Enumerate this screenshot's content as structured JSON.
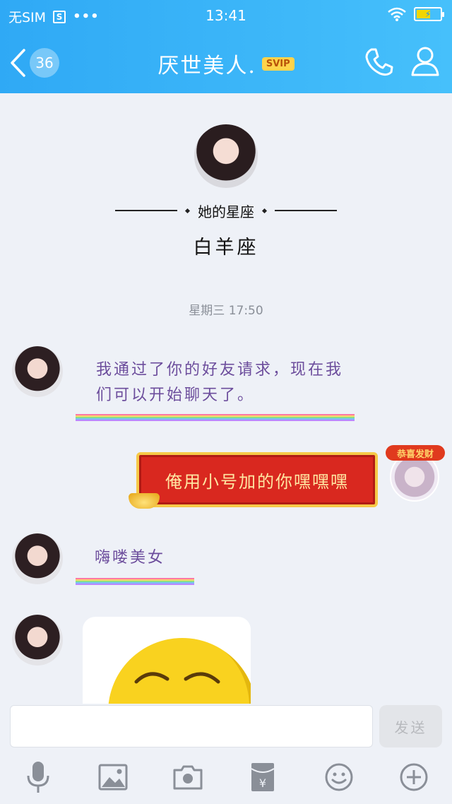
{
  "status_bar": {
    "carrier": "无SIM",
    "time": "13:41",
    "battery_level": 0.6
  },
  "nav": {
    "back_count": "36",
    "title": "厌世美人.",
    "vip_badge": "SVIP"
  },
  "profile": {
    "zodiac_label": "她的星座",
    "zodiac_value": "白羊座"
  },
  "chat": {
    "timestamp": "星期三 17:50",
    "messages": [
      {
        "sender": "other",
        "text": "我通过了你的好友请求，现在我们可以开始聊天了。"
      },
      {
        "sender": "me",
        "text": "俺用小号加的你嘿嘿嘿",
        "badge": "恭喜发财"
      },
      {
        "sender": "other",
        "text": "嗨喽美女"
      },
      {
        "sender": "other",
        "type": "image"
      }
    ]
  },
  "input": {
    "placeholder": "",
    "send_label": "发送"
  },
  "toolbar": [
    "mic-icon",
    "image-icon",
    "camera-icon",
    "red-packet-icon",
    "emoji-icon",
    "plus-icon"
  ],
  "colors": {
    "header": "#2fa9f5",
    "message_text": "#6c4d9c",
    "background": "#eef1f7"
  }
}
